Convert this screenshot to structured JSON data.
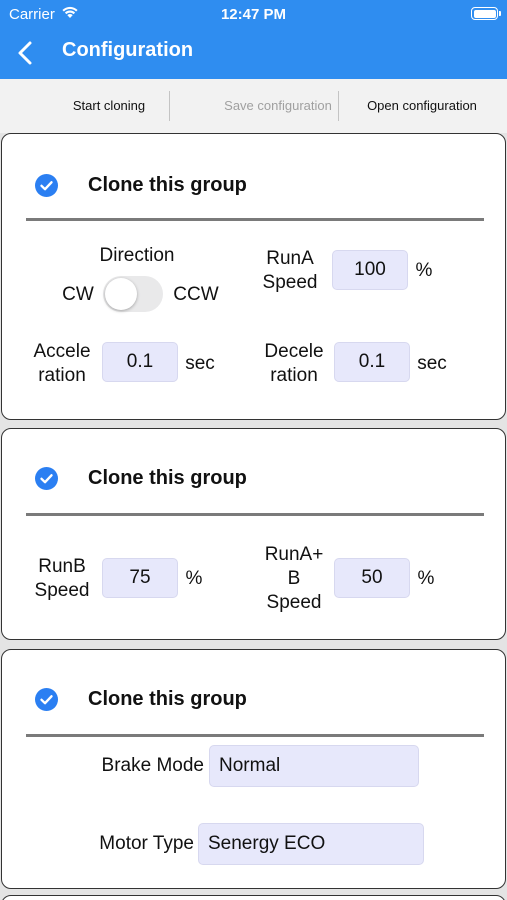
{
  "status_bar": {
    "carrier": "Carrier",
    "time": "12:47 PM"
  },
  "nav": {
    "title": "Configuration"
  },
  "toolbar": {
    "start_cloning": "Start cloning",
    "save_configuration": "Save configuration",
    "open_configuration": "Open configuration"
  },
  "groups": [
    {
      "clone_label": "Clone this group",
      "direction_label": "Direction",
      "cw_label": "CW",
      "ccw_label": "CCW",
      "runa_line1": "RunA",
      "runa_line2": "Speed",
      "runa_value": "100",
      "runa_unit": "%",
      "accel_line1": "Accele",
      "accel_line2": "ration",
      "accel_value": "0.1",
      "accel_unit": "sec",
      "decel_line1": "Decele",
      "decel_line2": "ration",
      "decel_value": "0.1",
      "decel_unit": "sec"
    },
    {
      "clone_label": "Clone this group",
      "runb_line1": "RunB",
      "runb_line2": "Speed",
      "runb_value": "75",
      "runb_unit": "%",
      "runab_line1": "RunA+",
      "runab_line2": "B",
      "runab_line3": "Speed",
      "runab_value": "50",
      "runab_unit": "%"
    },
    {
      "clone_label": "Clone this group",
      "brake_label": "Brake Mode",
      "brake_value": "Normal",
      "motor_label": "Motor Type",
      "motor_value": "Senergy ECO"
    }
  ],
  "colors": {
    "accent": "#2f8df0",
    "check": "#2b7ff2",
    "field_bg": "#e7e8fb"
  }
}
